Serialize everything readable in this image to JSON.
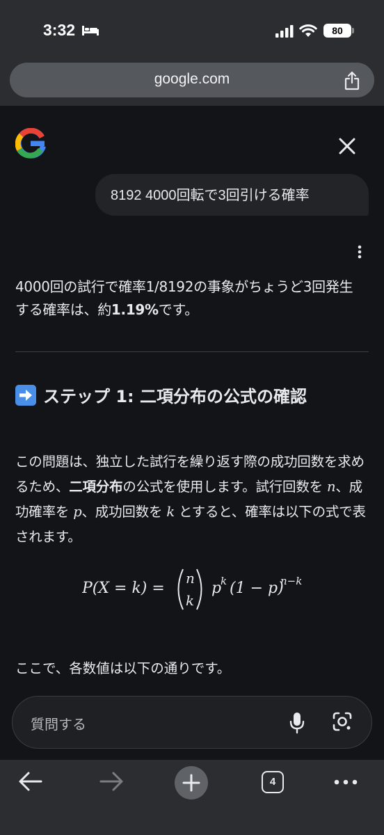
{
  "status_bar": {
    "time": "3:32",
    "battery": "80"
  },
  "browser": {
    "url": "google.com",
    "tab_count": "4"
  },
  "chat": {
    "user_query": "8192 4000回転で3回引ける確率",
    "answer_prefix": "4000回の試行で確率1/8192の事象がちょうど3回発生する確率は、約",
    "answer_bold": "1.19%",
    "answer_suffix": "です。",
    "step_heading": "ステップ 1: 二項分布の公式の確認",
    "body": {
      "p1": "この問題は、独立した試行を繰り返す際の成功回数を求めるため、",
      "bold": "二項分布",
      "p2": "の公式を使用します。試行回数を",
      "var_n": "n",
      "p3": "、成功確率を",
      "var_p": "p",
      "p4": "、成功回数を",
      "var_k": "k",
      "p5": "とすると、確率は以下の式で表されます。"
    },
    "formula": {
      "lhs": "P(X = k) =",
      "binom_top": "n",
      "binom_bottom": "k",
      "base1": "p",
      "exp1": "k",
      "base2": "(1 − p)",
      "exp2": "n−k"
    },
    "note": "ここで、各数値は以下の通りです。",
    "ask_placeholder": "質問する"
  }
}
